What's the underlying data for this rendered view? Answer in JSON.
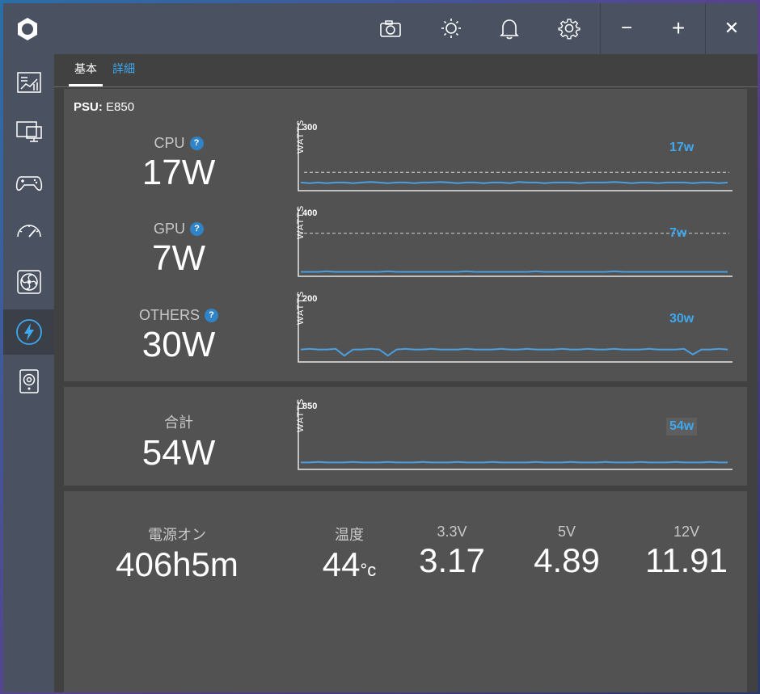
{
  "colors": {
    "accent": "#3ea8f0",
    "line": "#4a9fe0"
  },
  "header": {
    "icons": [
      "app-logo-icon",
      "camera-icon",
      "brightness-icon",
      "bell-icon",
      "gear-icon",
      "minimize-icon",
      "maximize-icon",
      "close-icon"
    ],
    "minimize_label": "−",
    "maximize_label": "+",
    "close_label": "✕"
  },
  "sidebar": {
    "items": [
      {
        "icon": "dashboard-icon",
        "active": false
      },
      {
        "icon": "monitor-icon",
        "active": false
      },
      {
        "icon": "gamepad-icon",
        "active": false
      },
      {
        "icon": "speedometer-icon",
        "active": false
      },
      {
        "icon": "fan-icon",
        "active": false
      },
      {
        "icon": "power-icon",
        "active": true
      },
      {
        "icon": "speaker-icon",
        "active": false
      }
    ]
  },
  "tabs": {
    "basic": "基本",
    "detail": "詳細"
  },
  "psu": {
    "label": "PSU:",
    "model": "E850"
  },
  "metrics": [
    {
      "name": "CPU",
      "value": "17W",
      "help": "?"
    },
    {
      "name": "GPU",
      "value": "7W",
      "help": "?"
    },
    {
      "name": "OTHERS",
      "value": "30W",
      "help": "?"
    }
  ],
  "charts": [
    {
      "max": "300",
      "unit": "WATTS",
      "current": "17w",
      "threshold_frac": 0.3,
      "values": [
        0.08,
        0.07,
        0.08,
        0.07,
        0.08,
        0.08,
        0.07,
        0.08,
        0.09,
        0.08,
        0.07,
        0.08,
        0.08,
        0.07,
        0.08,
        0.08,
        0.09,
        0.08,
        0.07,
        0.08,
        0.08,
        0.07,
        0.08,
        0.08,
        0.07,
        0.09,
        0.08,
        0.08,
        0.07,
        0.08,
        0.08,
        0.08,
        0.07,
        0.08,
        0.08,
        0.08,
        0.09,
        0.08,
        0.07,
        0.08,
        0.08,
        0.07,
        0.08,
        0.08,
        0.08,
        0.07,
        0.08,
        0.08,
        0.07,
        0.08
      ]
    },
    {
      "max": "400",
      "unit": "WATTS",
      "current": "7w",
      "threshold_frac": 0.7,
      "values": [
        0.02,
        0.02,
        0.02,
        0.03,
        0.02,
        0.02,
        0.02,
        0.02,
        0.02,
        0.02,
        0.03,
        0.02,
        0.02,
        0.02,
        0.02,
        0.02,
        0.02,
        0.02,
        0.02,
        0.03,
        0.02,
        0.02,
        0.02,
        0.02,
        0.02,
        0.02,
        0.02,
        0.03,
        0.02,
        0.02,
        0.02,
        0.02,
        0.02,
        0.02,
        0.02,
        0.02,
        0.03,
        0.02,
        0.02,
        0.02,
        0.02,
        0.02,
        0.02,
        0.02,
        0.02,
        0.02,
        0.02,
        0.02,
        0.02,
        0.02
      ]
    },
    {
      "max": "200",
      "unit": "WATTS",
      "current": "30w",
      "threshold_frac": null,
      "values": [
        0.15,
        0.16,
        0.15,
        0.15,
        0.16,
        0.05,
        0.15,
        0.15,
        0.16,
        0.15,
        0.05,
        0.15,
        0.16,
        0.15,
        0.15,
        0.16,
        0.15,
        0.15,
        0.15,
        0.16,
        0.15,
        0.15,
        0.15,
        0.16,
        0.15,
        0.15,
        0.16,
        0.15,
        0.15,
        0.15,
        0.16,
        0.15,
        0.15,
        0.16,
        0.15,
        0.15,
        0.16,
        0.15,
        0.15,
        0.15,
        0.16,
        0.15,
        0.15,
        0.15,
        0.16,
        0.07,
        0.15,
        0.15,
        0.16,
        0.15
      ]
    }
  ],
  "total": {
    "name": "合計",
    "value": "54W",
    "chart": {
      "max": "850",
      "unit": "WATTS",
      "current": "54w",
      "values": [
        0.06,
        0.06,
        0.07,
        0.06,
        0.06,
        0.06,
        0.07,
        0.06,
        0.06,
        0.06,
        0.07,
        0.06,
        0.06,
        0.06,
        0.07,
        0.06,
        0.06,
        0.06,
        0.07,
        0.06,
        0.06,
        0.06,
        0.07,
        0.06,
        0.06,
        0.06,
        0.06,
        0.07,
        0.06,
        0.06,
        0.06,
        0.07,
        0.06,
        0.06,
        0.06,
        0.07,
        0.06,
        0.06,
        0.06,
        0.07,
        0.06,
        0.06,
        0.06,
        0.07,
        0.06,
        0.06,
        0.06,
        0.07,
        0.06,
        0.06
      ]
    }
  },
  "stats": {
    "power_on": {
      "label": "電源オン",
      "value": "406h5m"
    },
    "temp": {
      "label": "温度",
      "value": "44",
      "unit": "°c"
    },
    "v33": {
      "label": "3.3V",
      "value": "3.17"
    },
    "v5": {
      "label": "5V",
      "value": "4.89"
    },
    "v12": {
      "label": "12V",
      "value": "11.91"
    }
  }
}
